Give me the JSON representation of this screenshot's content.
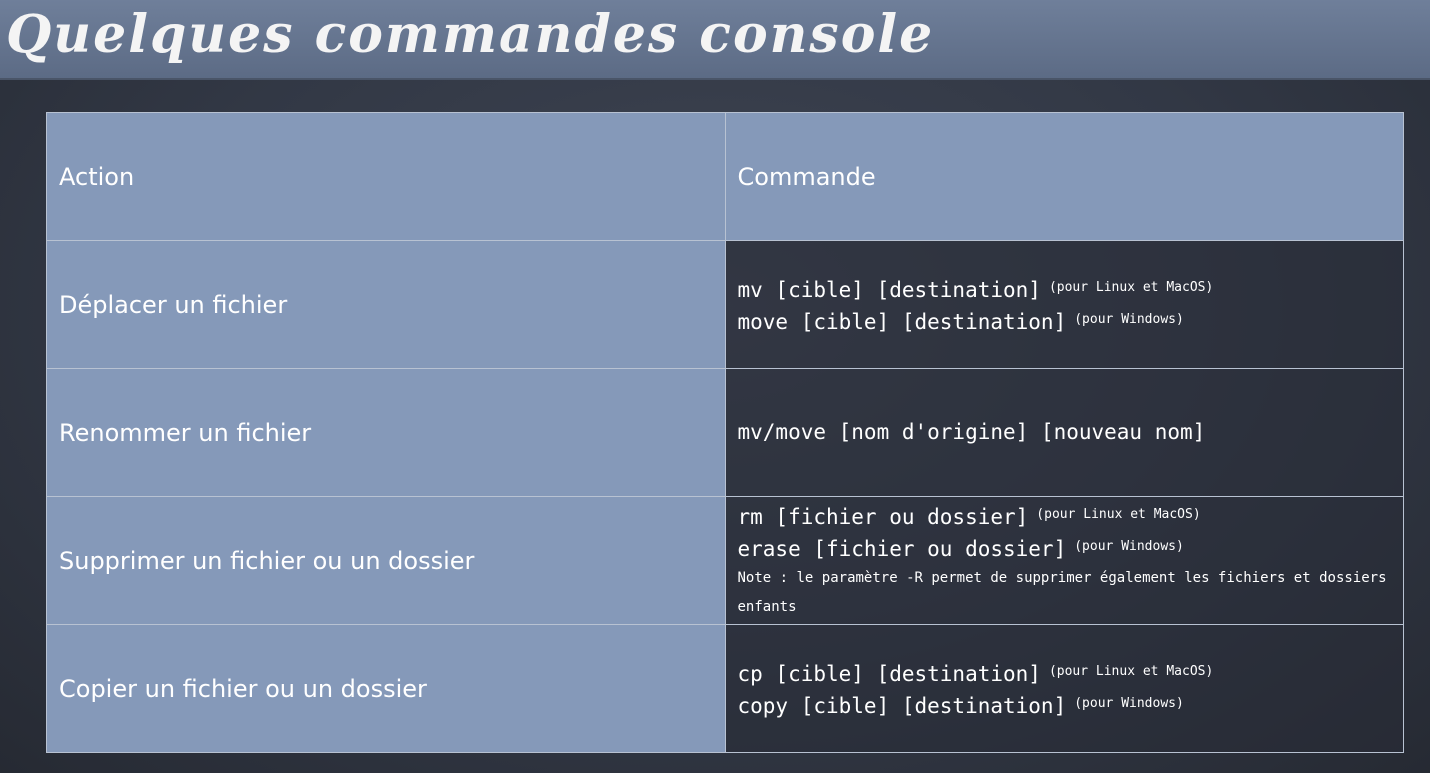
{
  "title": "Quelques commandes console",
  "table": {
    "headers": {
      "action": "Action",
      "command": "Commande"
    },
    "rows": [
      {
        "action": "Déplacer un fichier",
        "commands": [
          {
            "cmd": "mv [cible] [destination]",
            "hint": "(pour Linux et MacOS)"
          },
          {
            "cmd": "move [cible] [destination]",
            "hint": "(pour Windows)"
          }
        ]
      },
      {
        "action": "Renommer un fichier",
        "commands": [
          {
            "cmd": "mv/move [nom d'origine] [nouveau nom]"
          }
        ]
      },
      {
        "action": "Supprimer un fichier ou un dossier",
        "commands": [
          {
            "cmd": "rm [fichier ou dossier]",
            "hint": "(pour Linux et MacOS)"
          },
          {
            "cmd": "erase [fichier ou dossier]",
            "hint": "(pour Windows)"
          }
        ],
        "note": "Note : le paramètre -R permet de supprimer également les fichiers et dossiers enfants"
      },
      {
        "action": "Copier un fichier ou un dossier",
        "commands": [
          {
            "cmd": "cp [cible] [destination]",
            "hint": "(pour Linux et MacOS)"
          },
          {
            "cmd": "copy [cible] [destination]",
            "hint": "(pour Windows)"
          }
        ]
      }
    ]
  },
  "colors": {
    "title_bar": "#5c6b85",
    "action_cell": "#8599b9",
    "board_background": "#323845",
    "text": "#ffffff"
  }
}
